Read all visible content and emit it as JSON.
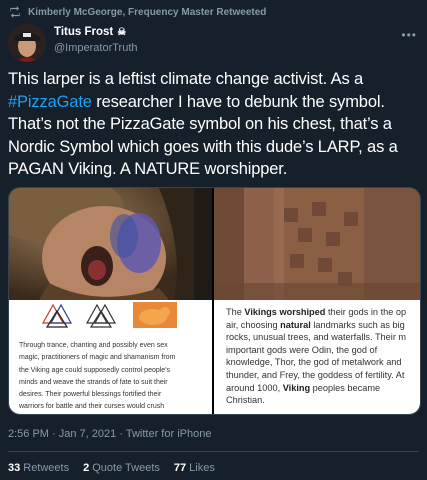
{
  "retweet": {
    "icon": "retweet-icon",
    "text": "Kimberly McGeorge, Frequency Master Retweeted"
  },
  "author": {
    "display_name": "Titus Frost",
    "badge_icon": "skull-crossbones-icon",
    "handle": "@ImperatorTruth"
  },
  "tweet": {
    "text_before": "This larper is a leftist climate change activist. As a ",
    "hashtag": "#PizzaGate",
    "text_after": " researcher I have to debunk the symbol. That’s not the PizzaGate symbol on his chest, that’s a Nordic Symbol which goes with this dude’s LARP, as a PAGAN Viking. A NATURE worshipper."
  },
  "media": {
    "left_text_lines": [
      "Through trance, chanting and possibly even sex",
      "magic, practitioners of magic and shamanism from",
      "the Viking age could supposedly control people's",
      "minds and weave the strands of fate to suit their",
      "desires. Their powerful blessings fortified their",
      "warriors for battle and their curses would crush"
    ],
    "right_text": {
      "l1_pre": "The ",
      "l1_b": "Vikings worshiped",
      "l1_post": " their gods in the op",
      "l2_pre": "air, choosing ",
      "l2_b": "natural",
      "l2_post": " landmarks such as big",
      "l3": "rocks, unusual trees, and waterfalls. Their m",
      "l4": "important gods were Odin, the god of",
      "l5": "knowledge, Thor, the god of metalwork and",
      "l6": "thunder, and Frey, the goddess of fertility. At",
      "l7_pre": "around 1000, ",
      "l7_b": "Viking",
      "l7_post": " peoples became",
      "l8": "Christian."
    }
  },
  "meta": {
    "time": "2:56 PM",
    "sep": "·",
    "date": "Jan 7, 2021",
    "source": "Twitter for iPhone"
  },
  "stats": {
    "retweets_count": "33",
    "retweets_label": "Retweets",
    "quotes_count": "2",
    "quotes_label": "Quote Tweets",
    "likes_count": "77",
    "likes_label": "Likes"
  },
  "colors": {
    "background": "#15202b",
    "muted": "#8899a6",
    "link": "#1da1f2",
    "border": "#38444d"
  }
}
